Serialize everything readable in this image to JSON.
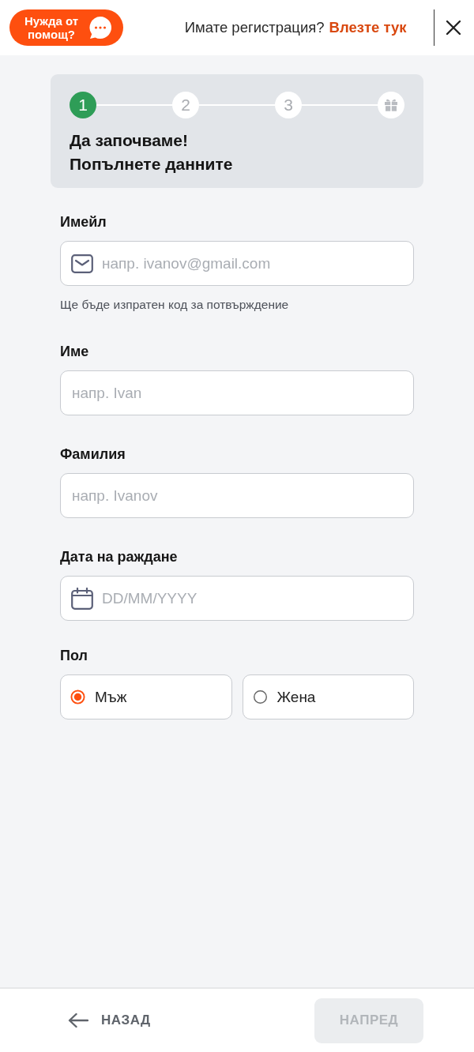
{
  "header": {
    "help_button": {
      "label": "Нужда от помощ?"
    },
    "login_prompt": "Имате регистрация?",
    "login_link": "Влезте тук"
  },
  "progress": {
    "steps": [
      {
        "kind": "number",
        "label": "1",
        "current": true
      },
      {
        "kind": "number",
        "label": "2",
        "current": false
      },
      {
        "kind": "number",
        "label": "3",
        "current": false
      },
      {
        "kind": "gift",
        "current": false
      }
    ],
    "title_lines": [
      "Да започваме!",
      "Попълнете данните"
    ]
  },
  "fields": [
    {
      "kind": "email",
      "label": "Имейл",
      "placeholder": "напр. ivanov@gmail.com",
      "hint": "Ще бъде изпратен код за потвърждение"
    },
    {
      "kind": "text",
      "label": "Име",
      "placeholder": "напр. Ivan"
    },
    {
      "kind": "text",
      "label": "Фамилия",
      "placeholder": "напр. Ivanov"
    },
    {
      "kind": "date",
      "label": "Дата на раждане",
      "placeholder": "DD/MM/YYYY"
    }
  ],
  "gender": {
    "label": "Пол",
    "options": [
      {
        "label": "Мъж",
        "selected": true
      },
      {
        "label": "Жена",
        "selected": false
      }
    ]
  },
  "footer": {
    "back": {
      "label": "НАЗАД"
    },
    "next": {
      "label": "НАПРЕД",
      "disabled": true
    }
  }
}
